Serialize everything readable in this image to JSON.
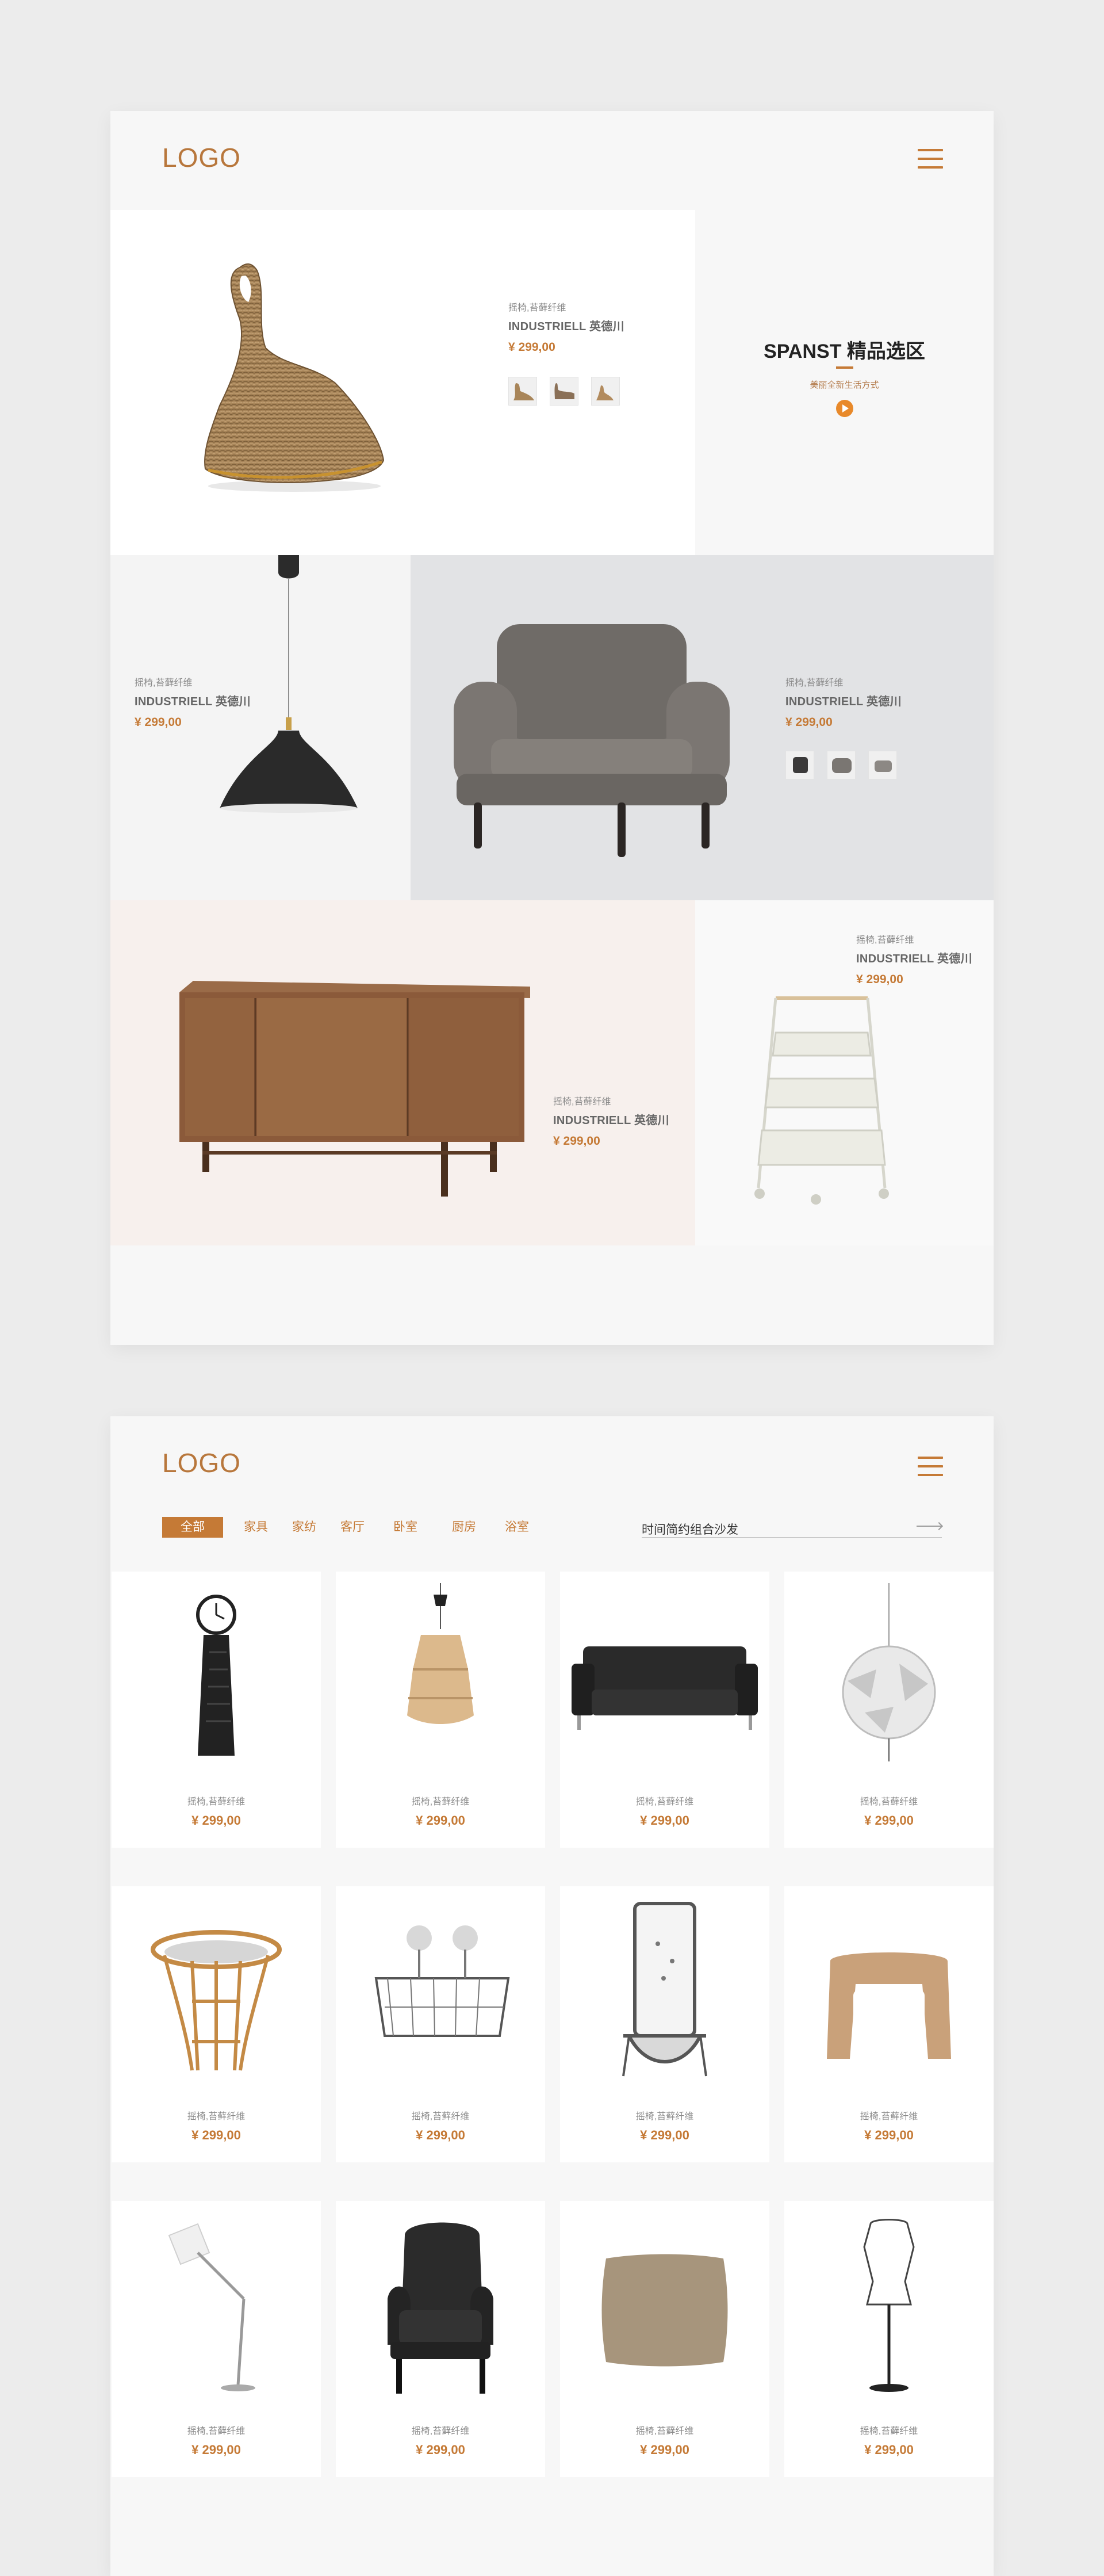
{
  "colors": {
    "accent": "#c57a36",
    "page_bg": "#ececec",
    "card_bg": "#f7f7f7",
    "grey_tile": "#e2e3e5",
    "pink_tile": "#f7f0ed"
  },
  "page1": {
    "logo": "LOGO",
    "hero": {
      "sub": "摇椅,苔藓纤维",
      "name": "INDUSTRIELL 英德川",
      "price": "¥ 299,00",
      "thumbs": [
        "rocking-chair-front",
        "rocking-chair-side",
        "rocking-chair-small"
      ]
    },
    "feature": {
      "title": "SPANST 精品选区",
      "sub": "美丽全新生活方式"
    },
    "lamp": {
      "sub": "摇椅,苔藓纤维",
      "name": "INDUSTRIELL 英德川",
      "price": "¥ 299,00"
    },
    "armchair": {
      "sub": "摇椅,苔藓纤维",
      "name": "INDUSTRIELL 英德川",
      "price": "¥ 299,00",
      "thumbs": [
        "armchair-dark",
        "armchair-grey",
        "armchair-small"
      ]
    },
    "sideboard": {
      "sub": "摇椅,苔藓纤维",
      "name": "INDUSTRIELL 英德川",
      "price": "¥ 299,00"
    },
    "trolley": {
      "sub": "摇椅,苔藓纤维",
      "name": "INDUSTRIELL 英德川",
      "price": "¥ 299,00"
    }
  },
  "page2": {
    "logo": "LOGO",
    "tabs": [
      "全部",
      "家具",
      "家纺",
      "客厅",
      "卧室",
      "厨房",
      "浴室"
    ],
    "active_tab": "全部",
    "search_value": "时间简约组合沙发",
    "products": [
      {
        "sub": "摇椅,苔藓纤维",
        "price": "¥ 299,00",
        "icon": "grandfather-clock"
      },
      {
        "sub": "摇椅,苔藓纤维",
        "price": "¥ 299,00",
        "icon": "wicker-pendant-lamp"
      },
      {
        "sub": "摇椅,苔藓纤维",
        "price": "¥ 299,00",
        "icon": "black-leather-sofa"
      },
      {
        "sub": "摇椅,苔藓纤维",
        "price": "¥ 299,00",
        "icon": "globe-pendant-lamp"
      },
      {
        "sub": "摇椅,苔藓纤维",
        "price": "¥ 299,00",
        "icon": "rattan-side-table"
      },
      {
        "sub": "摇椅,苔藓纤维",
        "price": "¥ 299,00",
        "icon": "wire-basket-shelf"
      },
      {
        "sub": "摇椅,苔藓纤维",
        "price": "¥ 299,00",
        "icon": "mirror-coat-rack"
      },
      {
        "sub": "摇椅,苔藓纤维",
        "price": "¥ 299,00",
        "icon": "bentwood-stool"
      },
      {
        "sub": "摇椅,苔藓纤维",
        "price": "¥ 299,00",
        "icon": "floor-lamp"
      },
      {
        "sub": "摇椅,苔藓纤维",
        "price": "¥ 299,00",
        "icon": "leather-wing-chair"
      },
      {
        "sub": "摇椅,苔藓纤维",
        "price": "¥ 299,00",
        "icon": "cushion"
      },
      {
        "sub": "摇椅,苔藓纤维",
        "price": "¥ 299,00",
        "icon": "dress-form-stand"
      }
    ]
  }
}
